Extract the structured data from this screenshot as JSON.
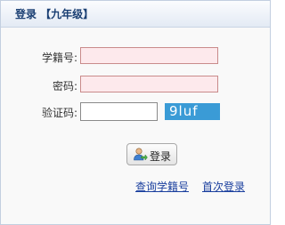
{
  "header": {
    "title": "登录 【九年级】"
  },
  "form": {
    "student_id_label": "学籍号:",
    "student_id_value": "",
    "password_label": "密码:",
    "password_value": "",
    "captcha_label": "验证码:",
    "captcha_value": "",
    "captcha_text": "9luf"
  },
  "actions": {
    "login_label": "登录",
    "query_link": "查询学籍号",
    "first_login_link": "首次登录"
  },
  "colors": {
    "header_text": "#1a3f73",
    "link": "#1a3f9e",
    "captcha_bg": "#3a9bd6",
    "field_bg": "#fde9ec",
    "field_border": "#c98b8b"
  }
}
